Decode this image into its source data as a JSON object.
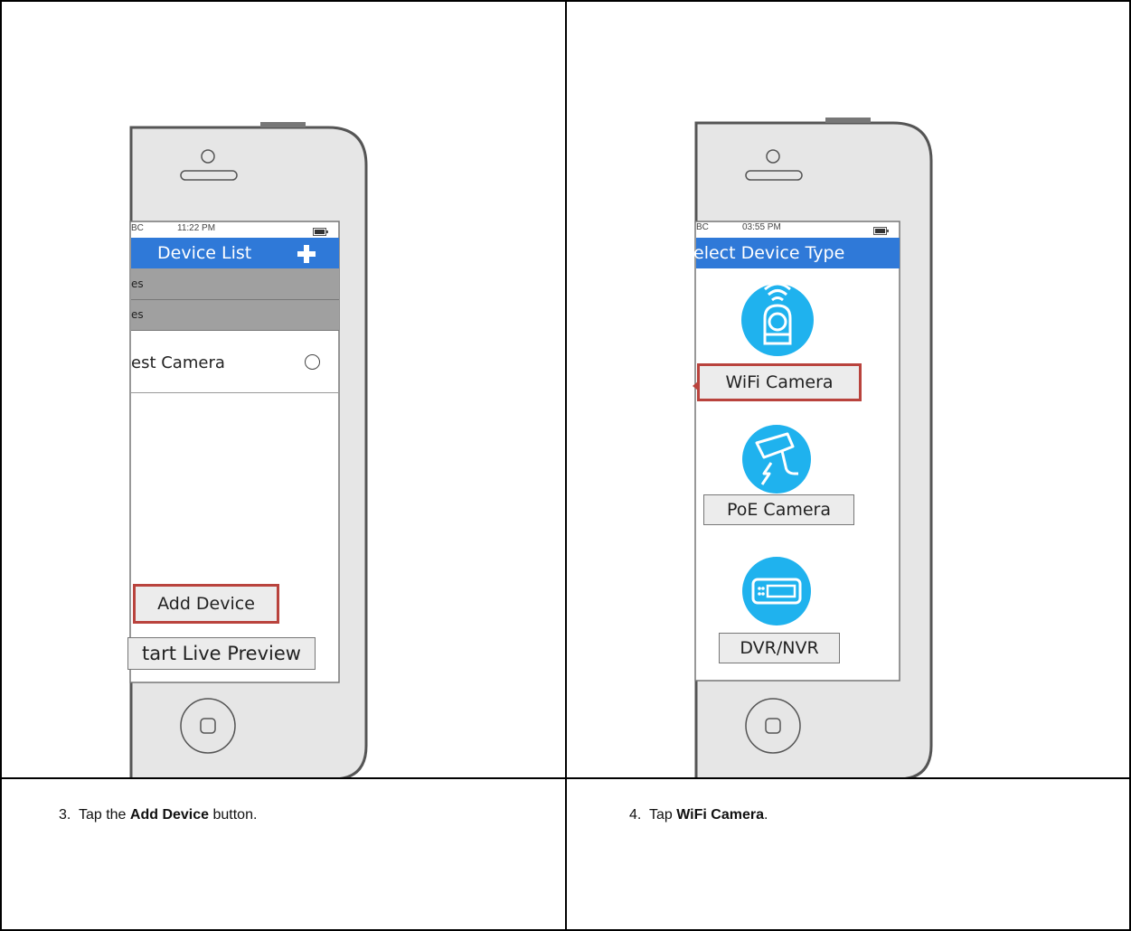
{
  "left_phone": {
    "status_carrier": "BC",
    "status_time": "11:22 PM",
    "header_title": "Device List",
    "group_row_1": "es",
    "group_row_2": "es",
    "device_name": "est Camera",
    "add_device_button": "Add Device",
    "start_live_preview_button": "tart Live Preview"
  },
  "right_phone": {
    "status_carrier": "BC",
    "status_time": "03:55 PM",
    "header_title": "elect Device Type",
    "wifi_camera_button": "WiFi Camera",
    "poe_camera_button": "PoE Camera",
    "dvr_nvr_button": "DVR/NVR"
  },
  "instructions": {
    "step3_number": "3.",
    "step3_prefix": "Tap the ",
    "step3_bold": "Add Device",
    "step3_suffix": " button.",
    "step4_number": "4.",
    "step4_prefix": "Tap ",
    "step4_bold": "WiFi Camera",
    "step4_suffix": "."
  },
  "colors": {
    "header_blue": "#2f79d8",
    "icon_cyan": "#1fb2ee",
    "highlight_red": "#b9433d",
    "phone_body": "#e6e6e6"
  }
}
